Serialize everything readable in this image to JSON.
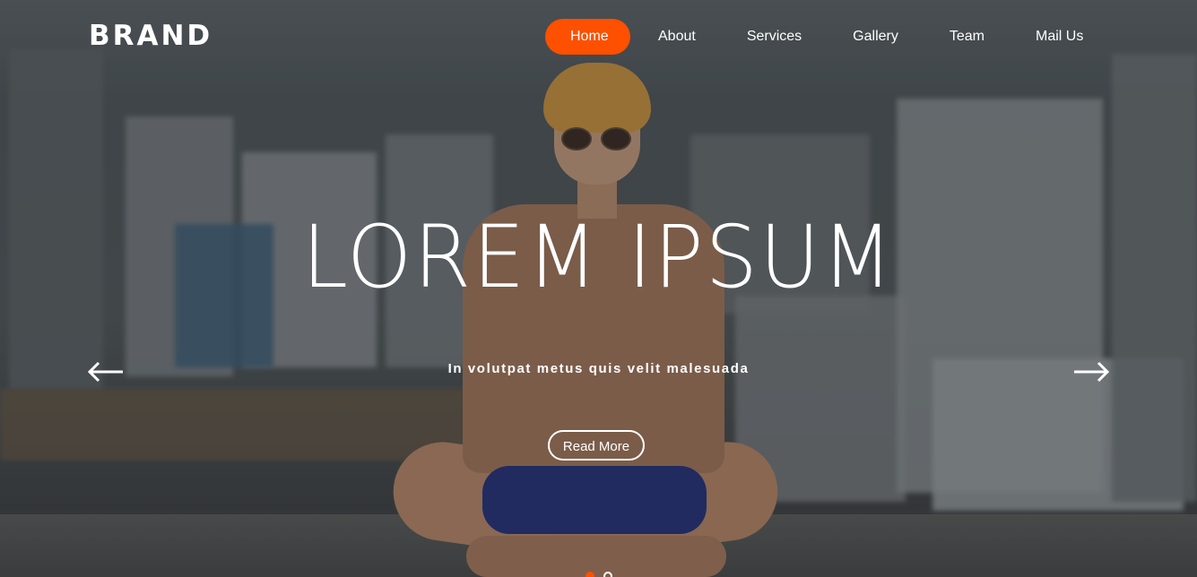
{
  "brand": "BRAND",
  "nav": {
    "items": [
      {
        "label": "Home",
        "active": true
      },
      {
        "label": "About",
        "active": false
      },
      {
        "label": "Services",
        "active": false
      },
      {
        "label": "Gallery",
        "active": false
      },
      {
        "label": "Team",
        "active": false
      },
      {
        "label": "Mail Us",
        "active": false
      }
    ]
  },
  "hero": {
    "title": "LOREM IPSUM",
    "subtitle": "In volutpat metus quis velit malesuada",
    "button_label": "Read More"
  },
  "carousel": {
    "prev_icon": "arrow-left-icon",
    "next_icon": "arrow-right-icon",
    "slide_count": 2,
    "active_slide": 1
  },
  "colors": {
    "accent": "#fd5000",
    "text": "#ffffff"
  }
}
